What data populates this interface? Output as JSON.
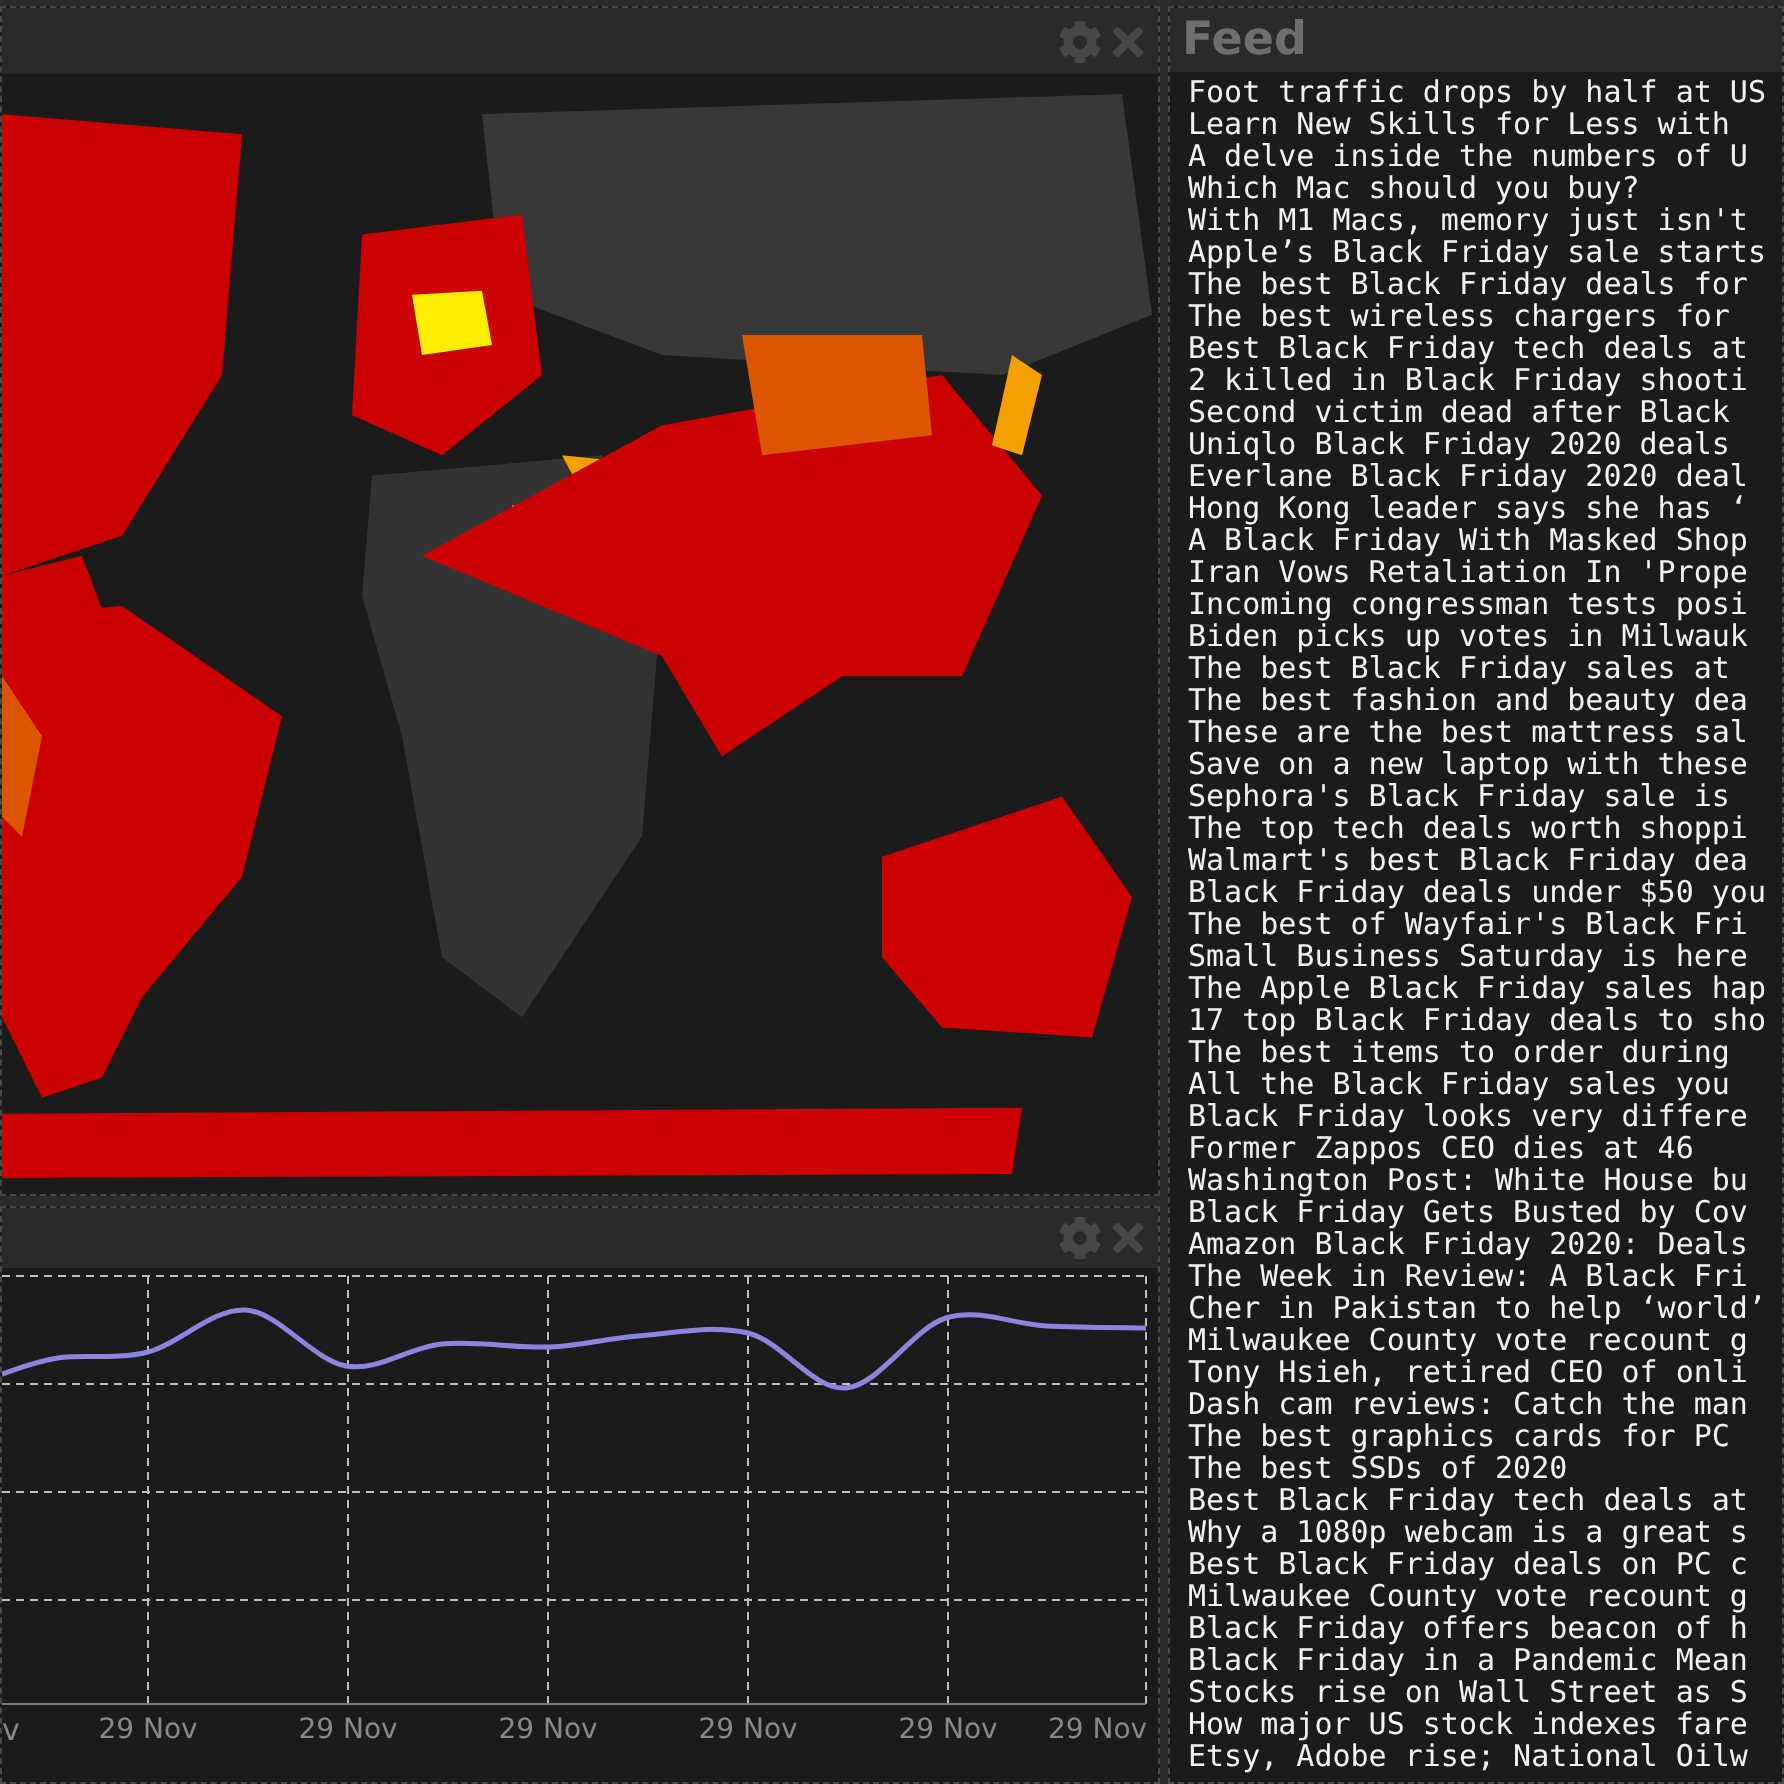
{
  "chart": {
    "x_labels": [
      "v",
      "29 Nov",
      "29 Nov",
      "29 Nov",
      "29 Nov",
      "29 Nov",
      "29 Nov"
    ]
  },
  "feed": {
    "title": "Feed",
    "items": [
      "Foot traffic drops by half at US",
      "Learn New Skills for Less with",
      "A delve inside the numbers of U",
      "Which Mac should you buy?",
      "With M1 Macs, memory just isn't",
      "Apple’s Black Friday sale starts",
      "The best Black Friday deals for",
      "The best wireless chargers for",
      "Best Black Friday tech deals at",
      "2 killed in Black Friday shooti",
      "Second victim dead after Black",
      "Uniqlo Black Friday 2020 deals",
      "Everlane Black Friday 2020 deal",
      "Hong Kong leader says she has ‘",
      "A Black Friday With Masked Shop",
      "Iran Vows Retaliation In 'Prope",
      "Incoming congressman tests posi",
      "Biden picks up votes in Milwauk",
      "The best Black Friday sales at",
      "The best fashion and beauty dea",
      "These are the best mattress sal",
      "Save on a new laptop with these",
      "Sephora's Black Friday sale is",
      "The top tech deals worth shoppi",
      "Walmart's best Black Friday dea",
      "Black Friday deals under $50 you",
      "The best of Wayfair's Black Fri",
      "Small Business Saturday is here",
      "The Apple Black Friday sales hap",
      "17 top Black Friday deals to sho",
      "The best items to order during",
      "All the Black Friday sales you",
      "Black Friday looks very differe",
      "Former Zappos CEO dies at 46",
      "Washington Post: White House bu",
      "Black Friday Gets Busted by Cov",
      "Amazon Black Friday 2020: Deals",
      "The Week in Review: A Black Fri",
      "Cher in Pakistan to help ‘world’",
      "Milwaukee County vote recount g",
      "Tony Hsieh, retired CEO of onli",
      "Dash cam reviews: Catch the man",
      "The best graphics cards for PC",
      "The best SSDs of 2020",
      "Best Black Friday tech deals at",
      "Why a 1080p webcam is a great s",
      "Best Black Friday deals on PC c",
      "Milwaukee County vote recount g",
      "Black Friday offers beacon of h",
      "Black Friday in a Pandemic Mean",
      "Stocks rise on Wall Street as S",
      "How major US stock indexes fare",
      "Etsy, Adobe rise; National Oilw"
    ]
  }
}
